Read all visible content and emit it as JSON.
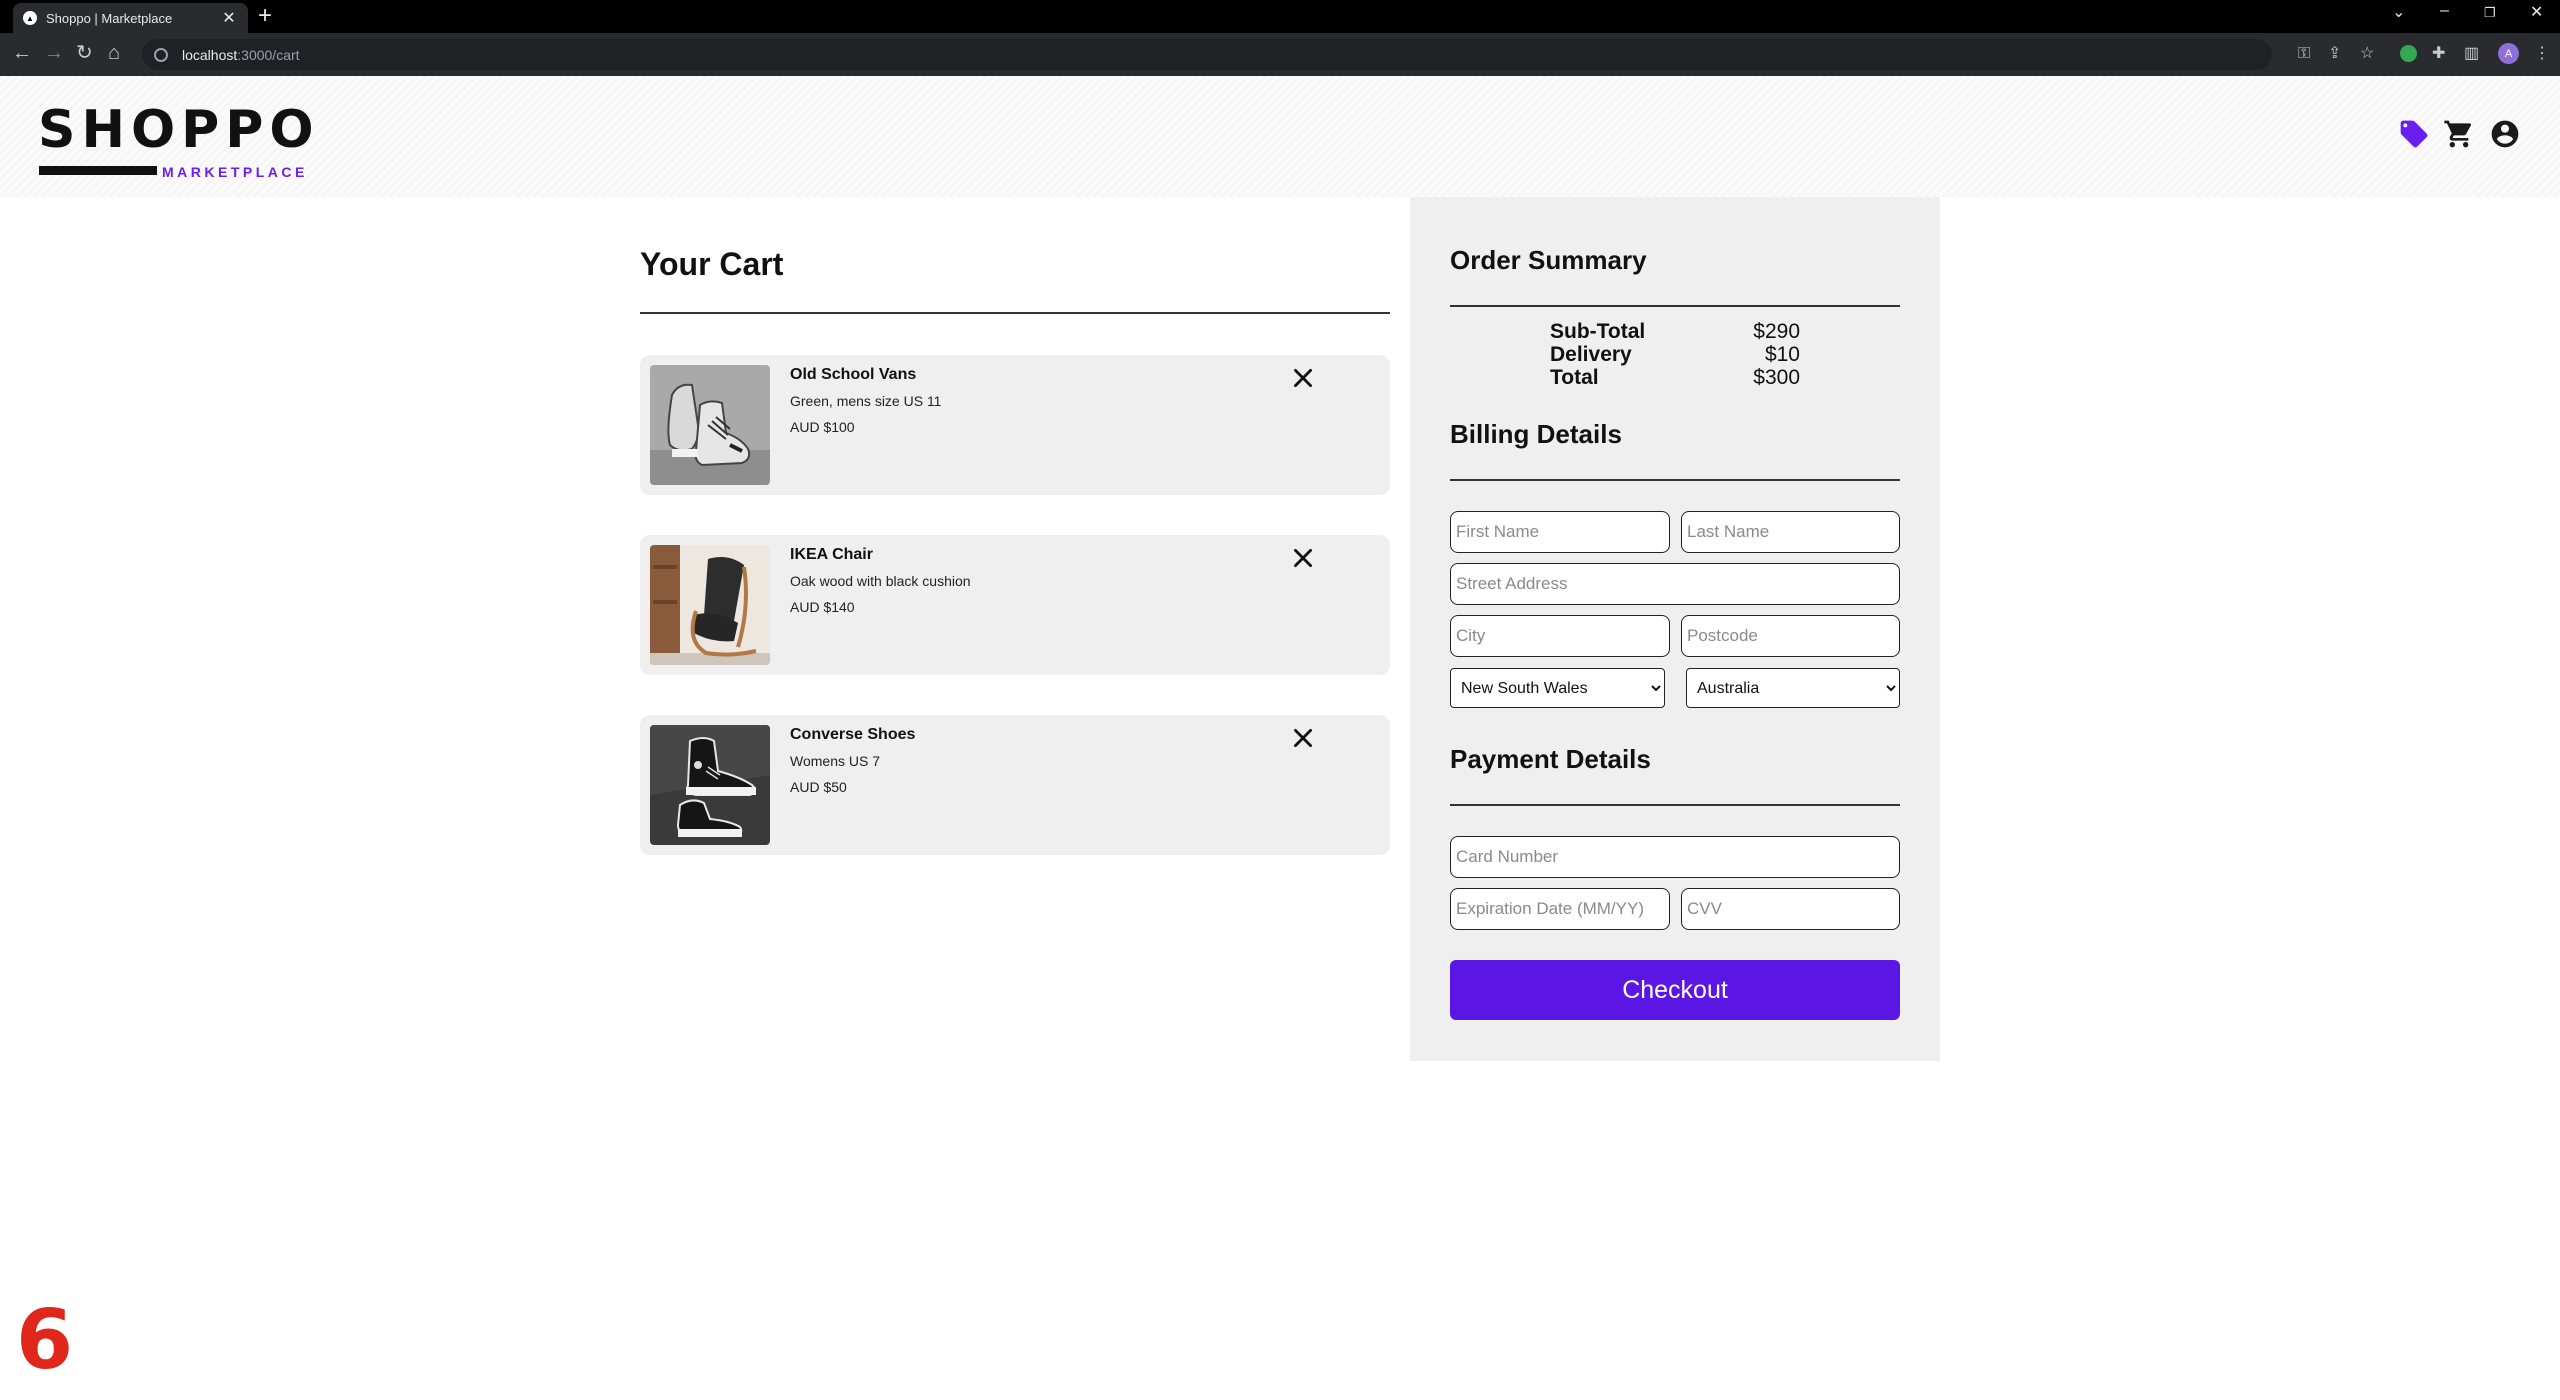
{
  "browser": {
    "tab_title": "Shoppo | Marketplace",
    "tab_close": "✕",
    "new_tab": "+",
    "url_host": "localhost",
    "url_path": ":3000/cart",
    "profile_initial": "A"
  },
  "header": {
    "logo_text": "SHOPPO",
    "logo_subtext": "MARKETPLACE",
    "accent_color": "#6a1ff0"
  },
  "cart": {
    "title": "Your Cart",
    "items": [
      {
        "name": "Old School Vans",
        "description": "Green, mens size US 11",
        "price": "AUD $100"
      },
      {
        "name": "IKEA Chair",
        "description": "Oak wood with black cushion",
        "price": "AUD $140"
      },
      {
        "name": "Converse Shoes",
        "description": "Womens US 7",
        "price": "AUD $50"
      }
    ]
  },
  "summary": {
    "title": "Order Summary",
    "rows": [
      {
        "label": "Sub-Total",
        "value": "$290"
      },
      {
        "label": "Delivery",
        "value": "$10"
      },
      {
        "label": "Total",
        "value": "$300"
      }
    ]
  },
  "billing": {
    "title": "Billing Details",
    "first_name_placeholder": "First Name",
    "last_name_placeholder": "Last Name",
    "street_placeholder": "Street Address",
    "city_placeholder": "City",
    "postcode_placeholder": "Postcode",
    "state_selected": "New South Wales",
    "country_selected": "Australia"
  },
  "payment": {
    "title": "Payment Details",
    "card_placeholder": "Card Number",
    "expiry_placeholder": "Expiration Date (MM/YY)",
    "cvv_placeholder": "CVV",
    "checkout_label": "Checkout",
    "button_color": "#5b16e6"
  },
  "overlay": {
    "step_number": "6"
  }
}
